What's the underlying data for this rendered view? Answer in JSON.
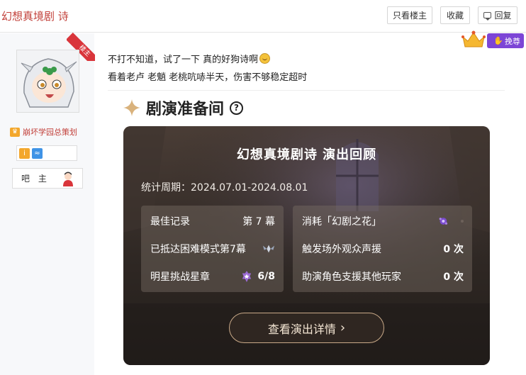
{
  "header": {
    "thread_title": "幻想真境剧 诗",
    "only_op_label": "只看楼主",
    "favorite_label": "收藏",
    "reply_label": "回复"
  },
  "author": {
    "op_tag": "楼主",
    "user_title": "崩坏学园总策划",
    "role_label": "吧 主"
  },
  "vip": {
    "label": "挽尊"
  },
  "post": {
    "line1": "不打不知道，试了一下 真的好狗诗啊",
    "line2": "看着老卢 老魈 老桃吭哧半天，伤害不够稳定超时"
  },
  "section": {
    "title": "剧演准备间",
    "help": "?"
  },
  "card": {
    "title": "幻想真境剧诗 演出回顾",
    "period": "统计周期：2024.07.01-2024.08.01",
    "left_stats": [
      {
        "label": "最佳记录",
        "value": "第 7 幕"
      },
      {
        "label": "已抵达困难模式第7幕",
        "value": ""
      },
      {
        "label": "明星挑战星章",
        "value": "6/8"
      }
    ],
    "right_stats": [
      {
        "label": "消耗「幻剧之花」",
        "value": ""
      },
      {
        "label": "触发场外观众声援",
        "value": "0 次"
      },
      {
        "label": "助演角色支援其他玩家",
        "value": "0 次"
      }
    ],
    "detail_button": "查看演出详情",
    "detail_arrow": "›"
  },
  "colors": {
    "accent_red": "#c2403a",
    "vip_purple": "#7c45d6",
    "card_dark": "#2f2824"
  }
}
